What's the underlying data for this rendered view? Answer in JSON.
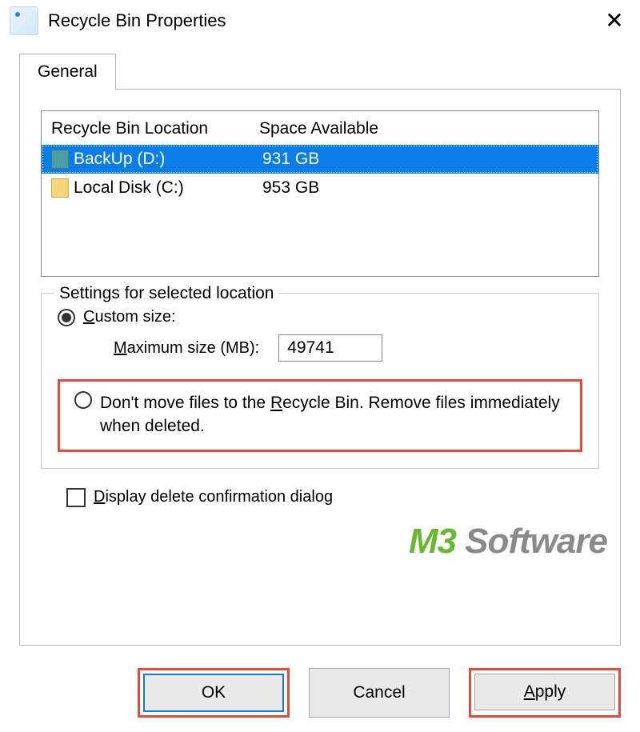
{
  "window": {
    "title": "Recycle Bin Properties"
  },
  "tabs": {
    "general": "General"
  },
  "list": {
    "headers": {
      "location": "Recycle Bin Location",
      "space": "Space Available"
    },
    "rows": [
      {
        "name": "BackUp (D:)",
        "space": "931 GB",
        "selected": true,
        "icon": "teal"
      },
      {
        "name": "Local Disk (C:)",
        "space": "953 GB",
        "selected": false,
        "icon": "yellow"
      }
    ]
  },
  "settings": {
    "legend": "Settings for selected location",
    "custom_size_prefix": "C",
    "custom_size_rest": "ustom size:",
    "max_size_prefix": "M",
    "max_size_rest": "aximum size (MB):",
    "max_size_value": "49741",
    "dont_move_before": "Don't move files to the ",
    "dont_move_u": "R",
    "dont_move_after": "ecycle Bin. Remove files immediately when deleted."
  },
  "confirmation": {
    "before": "",
    "u": "D",
    "after": "isplay delete confirmation dialog"
  },
  "buttons": {
    "ok": "OK",
    "cancel": "Cancel",
    "apply_u": "A",
    "apply_rest": "pply"
  },
  "watermark": {
    "m3": "M3",
    "soft": " Software"
  },
  "highlights": {
    "dont_move": true,
    "ok": true,
    "apply": true
  }
}
